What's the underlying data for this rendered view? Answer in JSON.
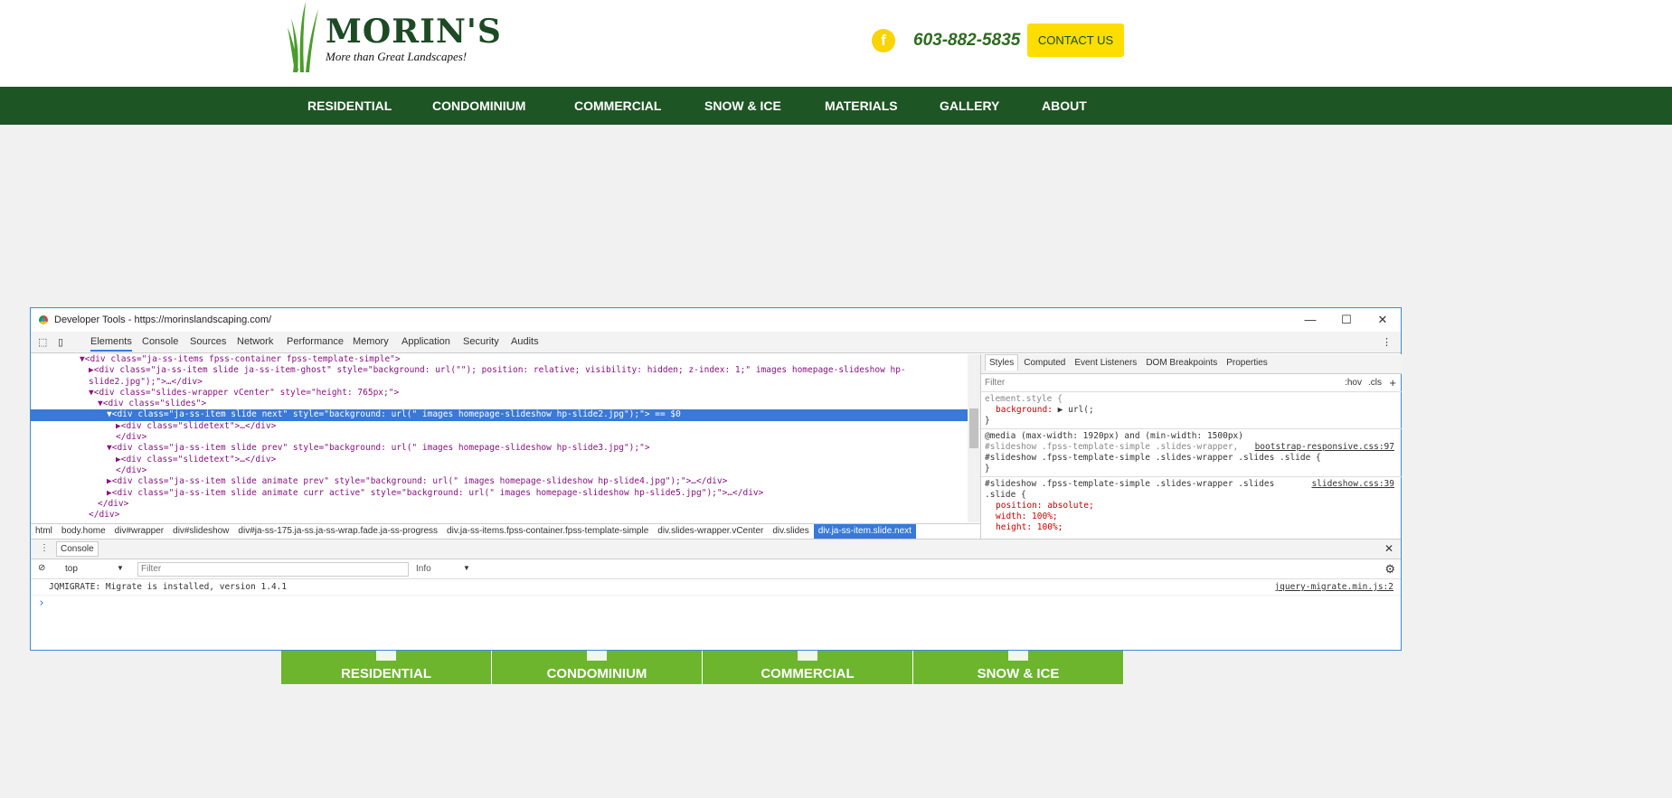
{
  "site": {
    "logo_title": "MORIN'S",
    "logo_tagline": "More than Great Landscapes!",
    "phone": "603-882-5835",
    "contact_label": "CONTACT US",
    "nav": [
      "RESIDENTIAL",
      "CONDOMINIUM",
      "COMMERCIAL",
      "SNOW & ICE",
      "MATERIALS",
      "GALLERY",
      "ABOUT"
    ],
    "tiles": [
      "RESIDENTIAL",
      "CONDOMINIUM",
      "COMMERCIAL",
      "SNOW & ICE"
    ],
    "colors": {
      "nav": "#1e5524",
      "accent": "#fedd00",
      "tile": "#6cb52d"
    }
  },
  "devtools": {
    "title": "Developer Tools - https://morinslandscaping.com/",
    "tabs": [
      "Elements",
      "Console",
      "Sources",
      "Network",
      "Performance",
      "Memory",
      "Application",
      "Security",
      "Audits"
    ],
    "dom_lines": [
      "▼<div class=\"ja-ss-items fpss-container fpss-template-simple\">",
      "▶<div class=\"ja-ss-item slide ja-ss-item-ghost\" style=\"background: url(\"\"); position: relative; visibility: hidden; z-index: 1;\" images homepage-slideshow hp-",
      "slide2.jpg\");\">…</div>",
      "▼<div class=\"slides-wrapper vCenter\" style=\"height: 765px;\">",
      "▼<div class=\"slides\">",
      "▼<div class=\"ja-ss-item slide next\" style=\"background: url(\" images homepage-slideshow hp-slide2.jpg\");\"> == $0",
      "▶<div class=\"slidetext\">…</div>",
      "</div>",
      "▼<div class=\"ja-ss-item slide prev\" style=\"background: url(\" images homepage-slideshow hp-slide3.jpg\");\">",
      "▶<div class=\"slidetext\">…</div>",
      "</div>",
      "▶<div class=\"ja-ss-item slide animate prev\" style=\"background: url(\" images homepage-slideshow hp-slide4.jpg\");\">…</div>",
      "▶<div class=\"ja-ss-item slide animate curr active\" style=\"background: url(\" images homepage-slideshow hp-slide5.jpg\");\">…</div>",
      "</div>",
      "</div>"
    ],
    "breadcrumbs": [
      "html",
      "body.home",
      "div#wrapper",
      "div#slideshow",
      "div#ja-ss-175.ja-ss.ja-ss-wrap.fade.ja-ss-progress",
      "div.ja-ss-items.fpss-container.fpss-template-simple",
      "div.slides-wrapper.vCenter",
      "div.slides",
      "div.ja-ss-item.slide.next"
    ],
    "styles_tabs": [
      "Styles",
      "Computed",
      "Event Listeners",
      "DOM Breakpoints",
      "Properties"
    ],
    "styles_filter": "Filter",
    "hov": ":hov",
    "cls": ".cls",
    "rules": {
      "r1_sel": "element.style {",
      "r1_prop": "background:",
      "r1_val": "▶ url(;",
      "close": "}",
      "r2_media": "@media (max-width: 1920px) and (min-width: 1500px)",
      "r2_sel1": "#slideshow .fpss-template-simple .slides-wrapper,",
      "r2_src": "bootstrap-responsive.css:97",
      "r2_sel2": "#slideshow .fpss-template-simple .slides-wrapper .slides .slide {",
      "r3_sel1": "#slideshow .fpss-template-simple .slides-wrapper .slides",
      "r3_src": "slideshow.css:39",
      "r3_sel2": ".slide {",
      "r3_p1": "position: absolute;",
      "r3_p2": "width: 100%;",
      "r3_p3": "height: 100%;"
    },
    "console": {
      "tab": "Console",
      "context": "top",
      "filter_placeholder": "Filter",
      "level": "Info",
      "message": "JQMIGRATE: Migrate is installed, version 1.4.1",
      "message_src": "jquery-migrate.min.js:2",
      "prompt": "›"
    }
  }
}
